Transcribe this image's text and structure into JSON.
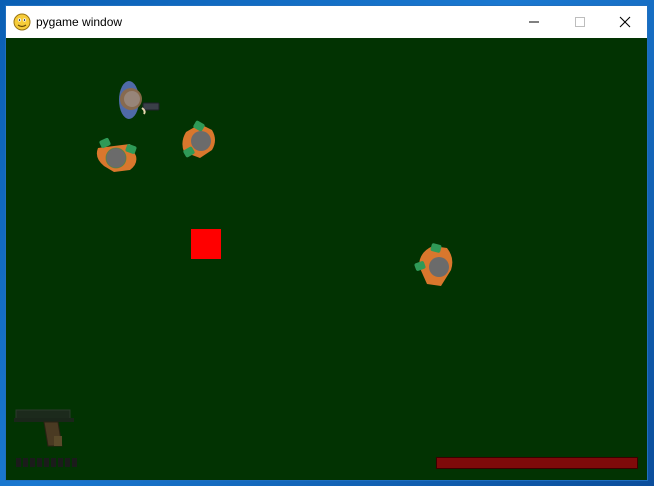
{
  "window": {
    "title": "pygame window",
    "icon": "pygame-snake-icon",
    "controls": [
      "minimize",
      "maximize",
      "close"
    ]
  },
  "game": {
    "background_color": "#023302",
    "player": {
      "icon": "player-soldier-with-gun"
    },
    "zombies": [
      {
        "icon": "zombie-icon"
      },
      {
        "icon": "zombie-icon"
      },
      {
        "icon": "zombie-icon"
      }
    ],
    "pickup": {
      "icon": "red-square",
      "color": "#ff0000"
    },
    "hud": {
      "weapon": {
        "icon": "pistol-icon"
      },
      "ammo_count": 9,
      "health_fraction": 1.0,
      "health_color": "#7f0a0a"
    }
  }
}
